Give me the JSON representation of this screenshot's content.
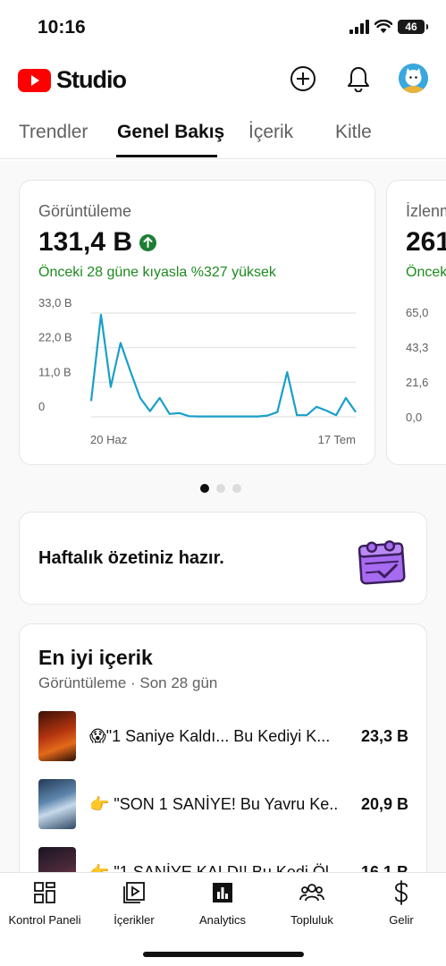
{
  "status_bar": {
    "time": "10:16",
    "battery": "46"
  },
  "header": {
    "app_name": "Studio",
    "icons": [
      "plus-circle-icon",
      "bell-icon",
      "avatar"
    ]
  },
  "tabs": [
    {
      "label": "Trendler",
      "active": false
    },
    {
      "label": "Genel Bakış",
      "active": true
    },
    {
      "label": "İçerik",
      "active": false
    },
    {
      "label": "Kitle",
      "active": false
    }
  ],
  "metric_cards": [
    {
      "label": "Görüntüleme",
      "value": "131,4 B",
      "trend": "up",
      "comparison": "Önceki 28 güne kıyasla %327 yüksek",
      "y_ticks": [
        "33,0 B",
        "22,0 B",
        "11,0 B",
        "0"
      ],
      "x_ticks": [
        "20 Haz",
        "17 Tem"
      ]
    },
    {
      "label": "İzlenm",
      "value": "261",
      "comparison": "Önceki",
      "y_ticks": [
        "65,0",
        "43,3",
        "21,6",
        "0,0"
      ]
    }
  ],
  "chart_data": {
    "type": "line",
    "title": "Görüntüleme",
    "xlabel": "",
    "ylabel": "",
    "x_tick_labels": [
      "20 Haz",
      "17 Tem"
    ],
    "y_tick_labels": [
      "0",
      "11,0 B",
      "22,0 B",
      "33,0 B"
    ],
    "ylim": [
      0,
      33000
    ],
    "grid": true,
    "color": "#1a9fc9",
    "x": [
      "20 Haz",
      "21 Haz",
      "22 Haz",
      "23 Haz",
      "24 Haz",
      "25 Haz",
      "26 Haz",
      "27 Haz",
      "28 Haz",
      "29 Haz",
      "30 Haz",
      "1 Tem",
      "2 Tem",
      "3 Tem",
      "4 Tem",
      "5 Tem",
      "6 Tem",
      "7 Tem",
      "8 Tem",
      "9 Tem",
      "10 Tem",
      "11 Tem",
      "12 Tem",
      "13 Tem",
      "14 Tem",
      "15 Tem",
      "16 Tem",
      "17 Tem"
    ],
    "values": [
      5000,
      32500,
      9500,
      23500,
      14500,
      6000,
      1800,
      6000,
      900,
      1200,
      200,
      100,
      100,
      100,
      100,
      100,
      100,
      100,
      400,
      1500,
      14200,
      500,
      500,
      3200,
      2000,
      500,
      6000,
      1500
    ]
  },
  "carousel": {
    "pages": 3,
    "active": 0
  },
  "weekly_summary": {
    "text": "Haftalık özetiniz hazır."
  },
  "top_content": {
    "title": "En iyi içerik",
    "subtitle": "Görüntüleme · Son 28 gün",
    "items": [
      {
        "title": "😱\"1 Saniye Kaldı... Bu Kediyi K...",
        "views": "23,3 B"
      },
      {
        "title": "👉 \"SON 1 SANİYE! Bu Yavru Ke...",
        "views": "20,9 B"
      },
      {
        "title": "👉 \"1 SANİYE KALDI! Bu Kedi Öl...",
        "views": "16,1 B"
      }
    ]
  },
  "bottom_nav": [
    {
      "label": "Kontrol Paneli",
      "icon": "dashboard-icon"
    },
    {
      "label": "İçerikler",
      "icon": "content-icon"
    },
    {
      "label": "Analytics",
      "icon": "analytics-icon",
      "active": true
    },
    {
      "label": "Topluluk",
      "icon": "community-icon"
    },
    {
      "label": "Gelir",
      "icon": "earn-icon"
    }
  ],
  "colors": {
    "brand": "#ff0000",
    "line": "#1a9fc9",
    "positive": "#1e8a1e"
  }
}
